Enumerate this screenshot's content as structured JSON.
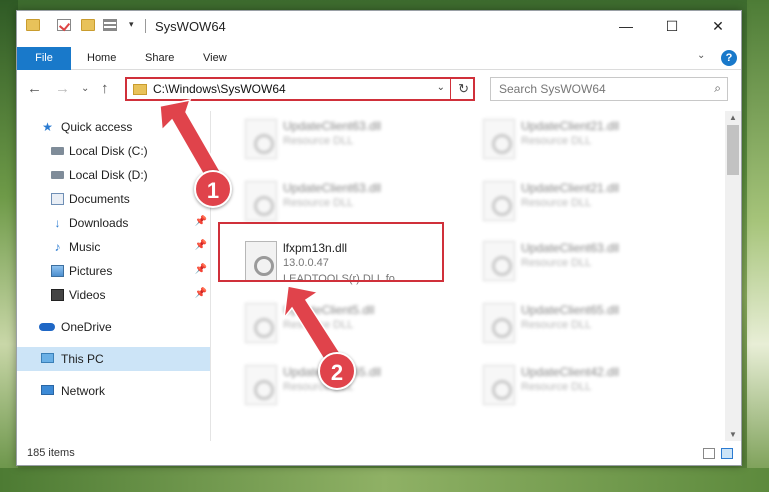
{
  "window": {
    "title": "SysWOW64",
    "qa_dropdown": "▾",
    "controls": {
      "minimize": "—",
      "maximize": "☐",
      "close": "✕"
    }
  },
  "ribbon": {
    "tabs": [
      {
        "label": "File"
      },
      {
        "label": "Home"
      },
      {
        "label": "Share"
      },
      {
        "label": "View"
      }
    ],
    "expand": "⌄",
    "help": "?"
  },
  "nav": {
    "back": "←",
    "forward": "→",
    "recent": "⌄",
    "up": "↑",
    "address": "C:\\Windows\\SysWOW64",
    "address_dropdown": "⌄",
    "refresh": "↻",
    "search_placeholder": "Search SysWOW64",
    "search_icon": "⌕"
  },
  "sidebar": {
    "items": [
      {
        "label": "Quick access",
        "icon": "star-icon"
      },
      {
        "label": "Local Disk (C:)",
        "icon": "disk-icon",
        "pin": "📌"
      },
      {
        "label": "Local Disk (D:)",
        "icon": "disk-icon"
      },
      {
        "label": "Documents",
        "icon": "documents-icon"
      },
      {
        "label": "Downloads",
        "icon": "downloads-icon",
        "pin": "📌"
      },
      {
        "label": "Music",
        "icon": "music-icon",
        "pin": "📌"
      },
      {
        "label": "Pictures",
        "icon": "pictures-icon",
        "pin": "📌"
      },
      {
        "label": "Videos",
        "icon": "videos-icon",
        "pin": "📌"
      },
      {
        "label": "OneDrive",
        "icon": "cloud-icon"
      },
      {
        "label": "This PC",
        "icon": "computer-icon",
        "selected": true
      },
      {
        "label": "Network",
        "icon": "network-icon"
      }
    ]
  },
  "files": [
    {
      "name": "UpdateClient63.dll",
      "line1": "Resource DLL",
      "blurred": true
    },
    {
      "name": "UpdateClient21.dll",
      "line1": "Resource DLL",
      "blurred": true
    },
    {
      "name": "UpdateClient63.dll",
      "line1": "Resource DLL",
      "blurred": true
    },
    {
      "name": "UpdateClient21.dll",
      "line1": "Resource DLL",
      "blurred": true
    },
    {
      "name": "lfxpm13n.dll",
      "line1": "13.0.0.47",
      "line2": "LEADTOOLS(r) DLL fo...",
      "blurred": false
    },
    {
      "name": "UpdateClient63.dll",
      "line1": "Resource DLL",
      "blurred": true
    },
    {
      "name": "UpdateClient5.dll",
      "line1": "Resource DLL",
      "blurred": true
    },
    {
      "name": "UpdateClient65.dll",
      "line1": "Resource DLL",
      "blurred": true
    },
    {
      "name": "UpdateClient65.dll",
      "line1": "Resource DLL",
      "blurred": true
    },
    {
      "name": "UpdateClient42.dll",
      "line1": "Resource DLL",
      "blurred": true
    }
  ],
  "scrollbar": {
    "up": "▲",
    "down": "▼"
  },
  "status": {
    "item_count": "185 items"
  },
  "callouts": {
    "step1": "1",
    "step2": "2"
  },
  "colors": {
    "accent": "#1979ca",
    "highlight": "#d0303a",
    "callout": "#e0434b",
    "selected": "#cce4f7"
  }
}
